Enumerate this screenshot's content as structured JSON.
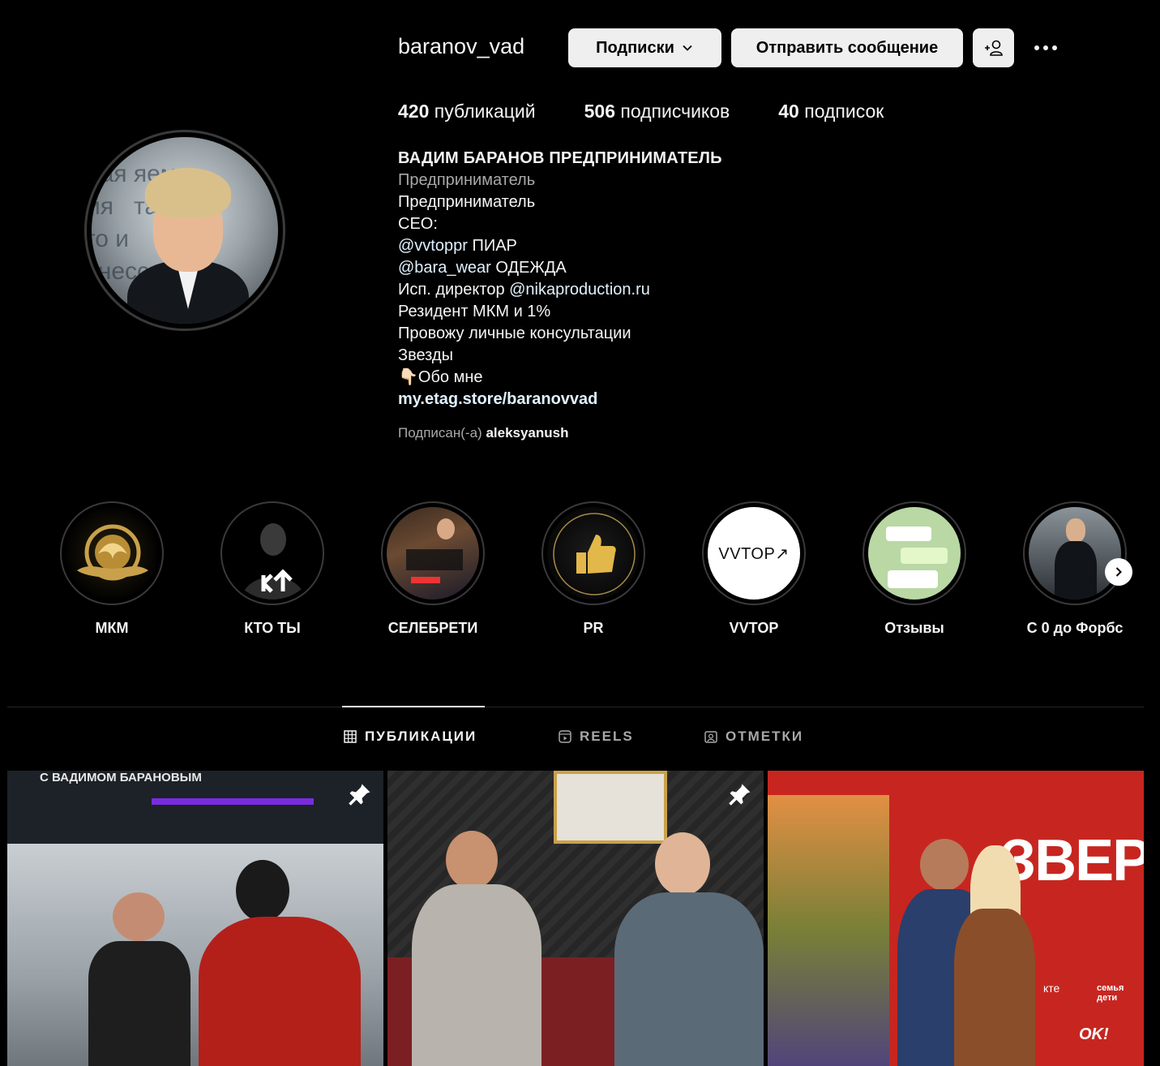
{
  "profile": {
    "username": "baranov_vad",
    "buttons": {
      "subscriptions": "Подписки",
      "message": "Отправить сообщение"
    },
    "stats": {
      "posts_count": "420",
      "posts_label": "публикаций",
      "followers_count": "506",
      "followers_label": "подписчиков",
      "following_count": "40",
      "following_label": "подписок"
    },
    "bio": {
      "name": "ВАДИМ БАРАНОВ ПРЕДПРИНИМАТЕЛЬ",
      "category": "Предприниматель",
      "line1": "Предприниматель",
      "line2": "CEO:",
      "line3_mention": "@vvtoppr",
      "line3_text": " ПИАР",
      "line4_mention": "@bara_wear",
      "line4_text": " ОДЕЖДА",
      "line5_text": "Исп. директор ",
      "line5_mention": "@nikaproduction.ru",
      "line6": "Резидент МКМ и 1%",
      "line7": "Провожу личные консультации",
      "line8": "Звезды",
      "line9": "👇🏻Обо мне",
      "link": "my.etag.store/baranovvad"
    },
    "followed_by_label": "Подписан(-а)",
    "followed_by_user": "aleksyanush"
  },
  "avatar_bg_text": "ная яемо\nия   тавит\nго и    него\nзнесс",
  "highlights": [
    {
      "label": "МКМ"
    },
    {
      "label": "КТО ТЫ"
    },
    {
      "label": "СЕЛЕБРЕТИ"
    },
    {
      "label": "PR"
    },
    {
      "label": "VVTOP",
      "logo": "VVTOP↗"
    },
    {
      "label": "Отзывы"
    },
    {
      "label": "С 0 до Форбс"
    }
  ],
  "tabs": [
    {
      "label": "ПУБЛИКАЦИИ",
      "icon": "grid-icon",
      "active": true
    },
    {
      "label": "REELS",
      "icon": "reels-icon",
      "active": false
    },
    {
      "label": "ОТМЕТКИ",
      "icon": "tagged-icon",
      "active": false
    }
  ],
  "posts": [
    {
      "pinned": true,
      "overlay_text": "С ВАДИМОМ БАРАНОВЫМ"
    },
    {
      "pinned": true
    },
    {
      "pinned": false,
      "overlay_text": "ЗВЕР",
      "badge1": "семья дети",
      "badge2": "OK!",
      "badge3": "кте"
    }
  ],
  "colors": {
    "background": "#000000",
    "button_bg": "#efefef",
    "mention": "#e0f1ff",
    "muted": "#a8a8a8"
  }
}
